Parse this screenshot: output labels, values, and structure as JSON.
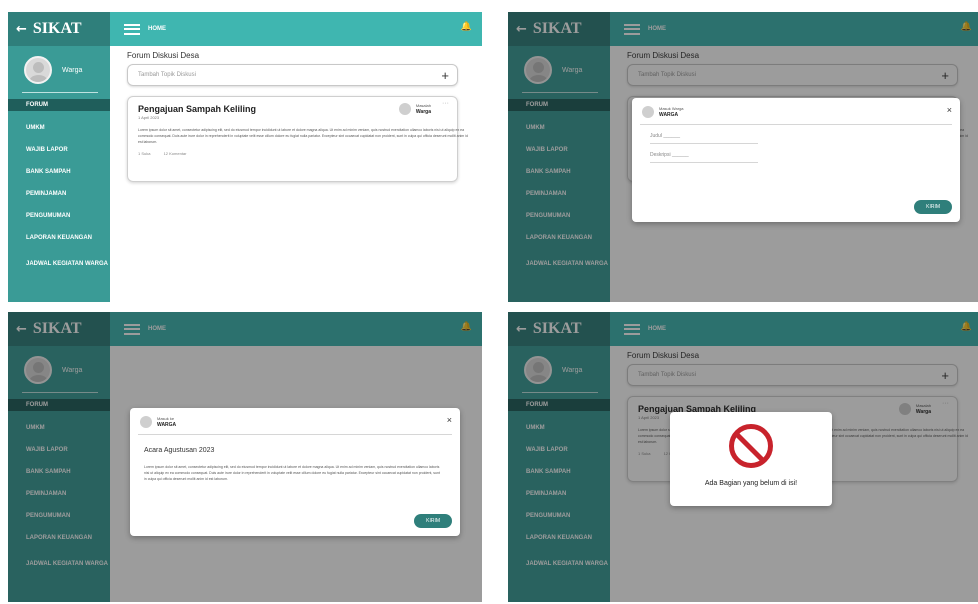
{
  "app": {
    "brand": "SIKAT",
    "back_arrow": "←",
    "user_name": "Warga",
    "page": "HOME",
    "bell_icon": "bell-icon"
  },
  "menu": [
    {
      "label": "FORUM",
      "active": true
    },
    {
      "label": "UMKM"
    },
    {
      "label": "WAJIB LAPOR"
    },
    {
      "label": "BANK SAMPAH"
    },
    {
      "label": "PEMINJAMAN"
    },
    {
      "label": "PENGUMUMAN"
    },
    {
      "label": "LAPORAN KEUANGAN"
    },
    {
      "label": "JADWAL KEGIATAN WARGA"
    }
  ],
  "forum": {
    "title": "Forum Diskusi Desa",
    "new_topic_placeholder": "Tambah Topik Diskusi",
    "plus": "+",
    "post": {
      "title": "Pengajuan Sampah Keliling",
      "date": "1 April 2023",
      "author_role": "Masalah",
      "author_name": "Warga",
      "dots": "···",
      "body": "Lorem ipsum dolor sit amet, consectetur adipiscing elit, sed do eiusmod tempor incididunt ut labore et dolore magna aliqua. Ut enim ad minim veniam, quis nostrud exercitation ullamco laboris nisi ut aliquip ex ea commodo consequat. Duis aute irure dolor in reprehenderit in voluptate velit esse cillum dolore eu fugiat nulla pariatur. Excepteur sint occaecat cupidatat non proident, sunt in culpa qui officia deserunt mollit anim id est laborum.",
      "meta_like": "1 Suka",
      "meta_comment": "12 Komentar"
    }
  },
  "modal_new_topic": {
    "author_line1": "Masuk Warga",
    "author_line2": "WARGA",
    "close": "×",
    "field_title": "Judul ______",
    "field_desc": "Deskripsi ______",
    "submit": "KIRIM"
  },
  "modal_post": {
    "author_line1": "Masuk ke",
    "author_line2": "WARGA",
    "close": "×",
    "title": "Acara Agustusan 2023",
    "body": "Lorem ipsum dolor sit amet, consectetur adipiscing elit, sed do eiusmod tempor incididunt ut labore et dolore magna aliqua. Ut enim ad minim veniam, quis nostrud exercitation ullamco laboris nisi ut aliquip ex ea commodo consequat. Duis aute irure dolor in reprehenderit in voluptate velit esse cillum dolore eu fugiat nulla pariatur. Excepteur sint occaecat cupidatat non proident, sunt in culpa qui officia deserunt mollit anim id est laborum.",
    "submit": "KIRIM"
  },
  "modal_error": {
    "icon": "prohibited-icon",
    "message": "Ada Bagian yang belum di isi!"
  },
  "colors": {
    "sidebar": "#3a9b96",
    "topbar": "#3fb6b0",
    "active_menu": "#1f5e5b",
    "button": "#2f7f7b",
    "error": "#c8232c"
  }
}
